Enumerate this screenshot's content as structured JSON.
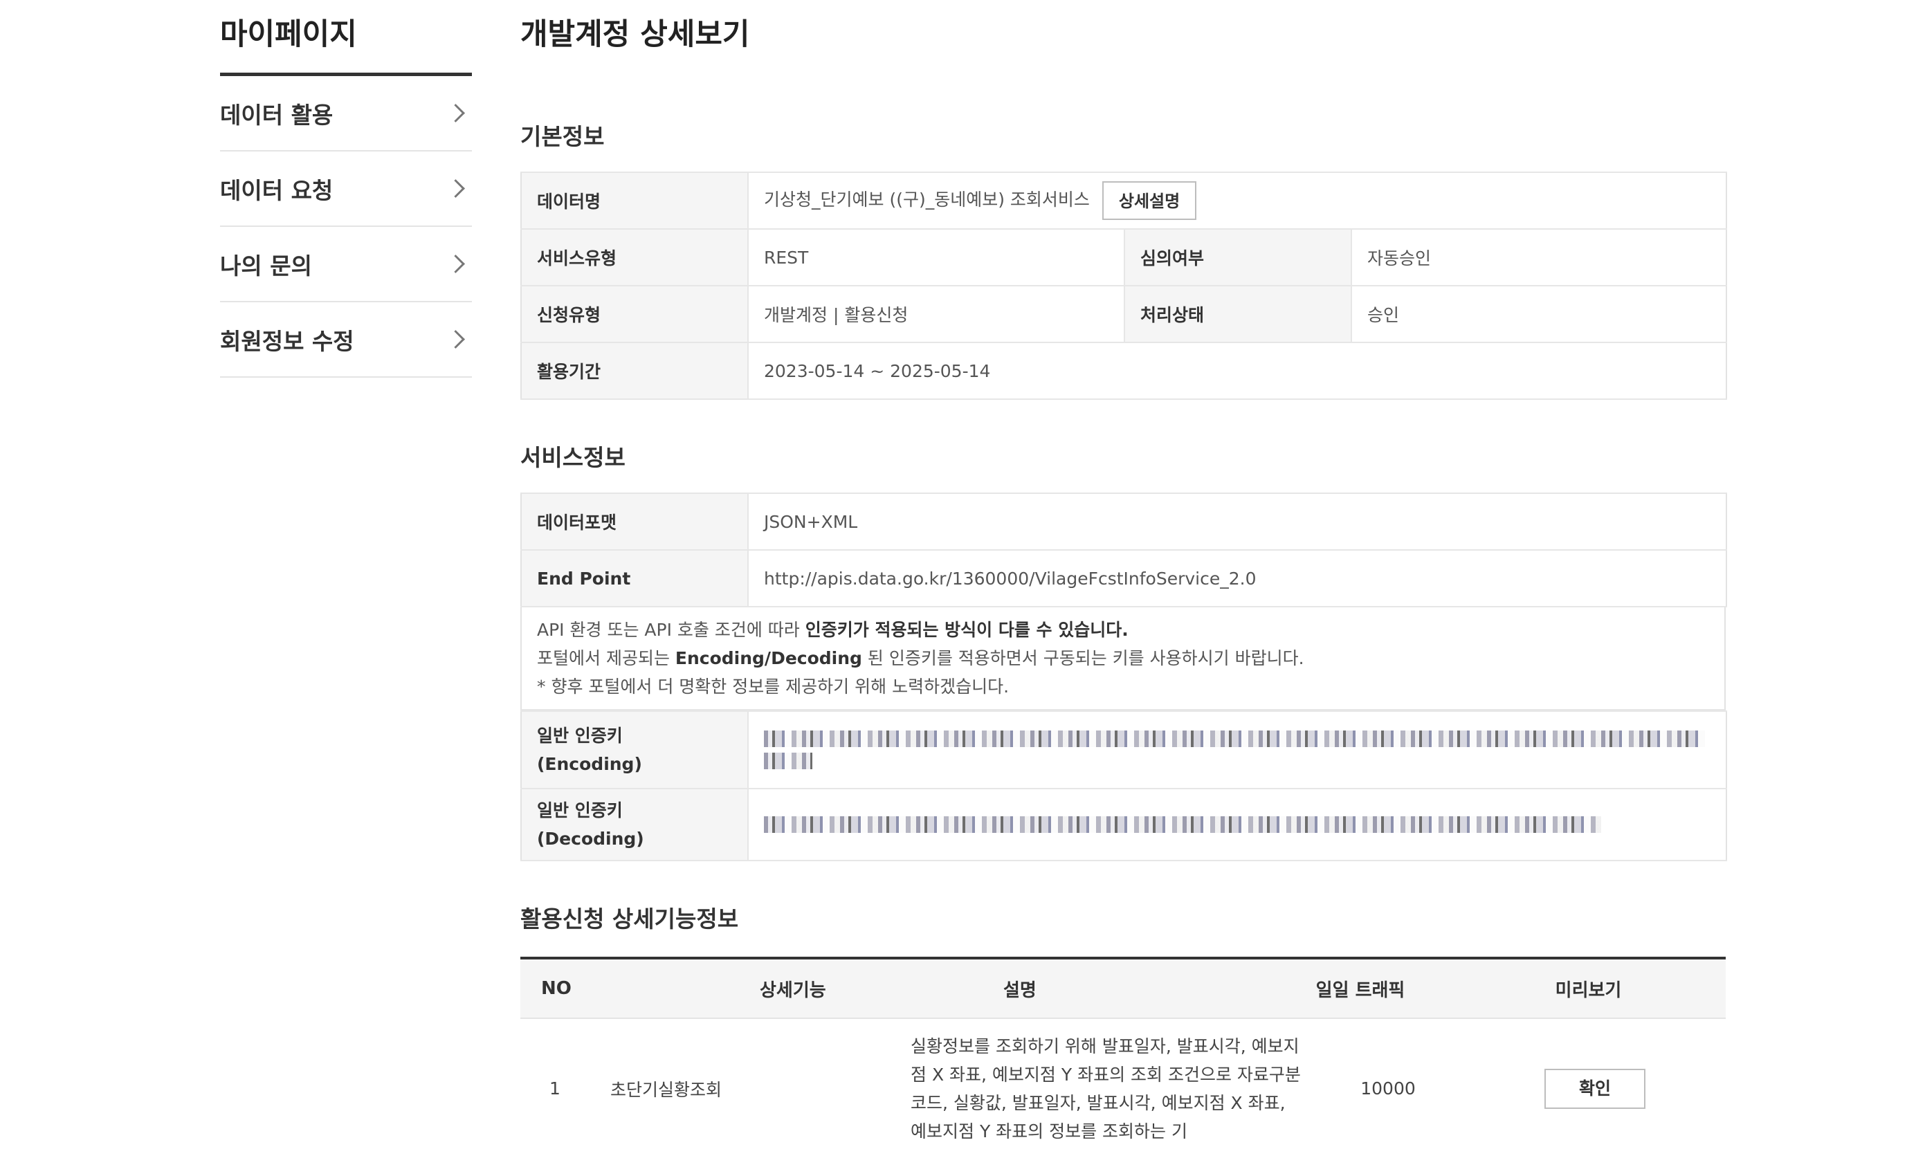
{
  "sidebar": {
    "title": "마이페이지",
    "items": [
      {
        "label": "데이터 활용"
      },
      {
        "label": "데이터 요청"
      },
      {
        "label": "나의 문의"
      },
      {
        "label": "회원정보 수정"
      }
    ]
  },
  "page": {
    "title": "개발계정 상세보기"
  },
  "basic_info": {
    "title": "기본정보",
    "data_name_label": "데이터명",
    "data_name_value": "기상청_단기예보 ((구)_동네예보) 조회서비스",
    "detail_button": "상세설명",
    "service_type_label": "서비스유형",
    "service_type_value": "REST",
    "review_label": "심의여부",
    "review_value": "자동승인",
    "apply_type_label": "신청유형",
    "apply_type_value": "개발계정 | 활용신청",
    "status_label": "처리상태",
    "status_value": "승인",
    "period_label": "활용기간",
    "period_value": "2023-05-14 ~ 2025-05-14"
  },
  "service_info": {
    "title": "서비스정보",
    "format_label": "데이터포맷",
    "format_value": "JSON+XML",
    "endpoint_label": "End Point",
    "endpoint_value": "http://apis.data.go.kr/1360000/VilageFcstInfoService_2.0",
    "notice_line1_a": "API 환경 또는 API 호출 조건에 따라 ",
    "notice_line1_b": "인증키가 적용되는 방식이 다를 수 있습니다.",
    "notice_line2_a": "포털에서 제공되는 ",
    "notice_line2_b": "Encoding/Decoding",
    "notice_line2_c": " 된 인증키를 적용하면서 구동되는 키를 사용하시기 바랍니다.",
    "notice_line3": "* 향후 포털에서 더 명확한 정보를 제공하기 위해 노력하겠습니다.",
    "encoding_label_1": "일반 인증키",
    "encoding_label_2": "(Encoding)",
    "decoding_label_1": "일반 인증키",
    "decoding_label_2": "(Decoding)"
  },
  "detail_features": {
    "title": "활용신청 상세기능정보",
    "headers": {
      "no": "NO",
      "feature": "상세기능",
      "description": "설명",
      "traffic": "일일 트래픽",
      "preview": "미리보기"
    },
    "rows": [
      {
        "no": "1",
        "feature": "초단기실황조회",
        "description": "실황정보를 조회하기 위해 발표일자, 발표시각, 예보지점 X 좌표, 예보지점 Y 좌표의 조회 조건으로 자료구분코드, 실황값, 발표일자, 발표시각, 예보지점 X 좌표, 예보지점 Y 좌표의 정보를 조회하는 기",
        "traffic": "10000",
        "preview_button": "확인"
      }
    ]
  }
}
